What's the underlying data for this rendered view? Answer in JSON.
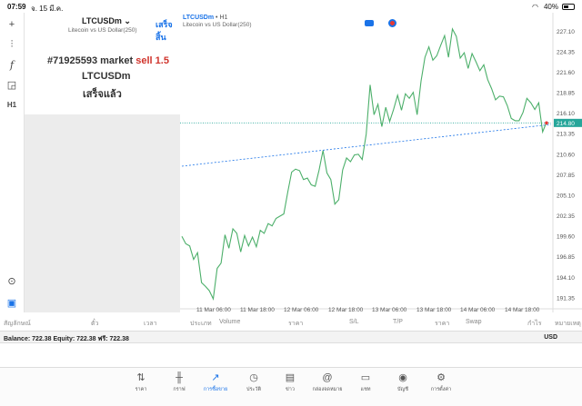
{
  "status": {
    "time": "07:59",
    "date": "จ. 15 มี.ค.",
    "battery": "40%"
  },
  "symbol": {
    "name": "LTCUSDm",
    "description": "Litecoin vs US Dollar(250)",
    "done_label": "เสร็จสิ้น"
  },
  "order": {
    "ticket": "#71925593 market",
    "side": "sell 1.5",
    "symbol": "LTCUSDm",
    "status": "เสร็จแล้ว"
  },
  "chart_header": {
    "symbol": "LTCUSDm",
    "timeframe": "H1",
    "description": "Litecoin vs US Dollar(250)"
  },
  "chart_data": {
    "type": "line",
    "y_ticks": [
      "227.10",
      "224.35",
      "221.60",
      "218.85",
      "216.10",
      "213.35",
      "210.60",
      "207.85",
      "205.10",
      "202.35",
      "199.60",
      "196.85",
      "194.10",
      "191.35"
    ],
    "x_ticks": [
      "11 Mar 06:00",
      "11 Mar 18:00",
      "12 Mar 06:00",
      "12 Mar 18:00",
      "13 Mar 06:00",
      "13 Mar 18:00",
      "14 Mar 06:00",
      "14 Mar 18:00"
    ],
    "current_price": "214.80",
    "ylim": [
      190.0,
      228.6
    ],
    "series": [
      {
        "values": [
          199.6,
          198.6,
          198.3,
          196.5,
          197.4,
          193.4,
          192.9,
          192.3,
          191.2,
          195.3,
          196.0,
          199.8,
          198.0,
          200.6,
          200.0,
          197.5,
          199.7,
          198.3,
          199.5,
          198.2,
          200.4,
          200.0,
          201.3,
          201.0,
          202.0,
          202.3,
          202.6,
          205.5,
          208.2,
          208.6,
          208.4,
          207.2,
          207.4,
          206.5,
          206.3,
          208.5,
          211.1,
          208.1,
          207.2,
          203.9,
          204.5,
          208.5,
          210.1,
          209.6,
          210.5,
          210.6,
          209.9,
          213.3,
          219.9,
          215.9,
          217.3,
          214.3,
          216.9,
          215.0,
          216.6,
          218.5,
          216.5,
          218.7,
          218.1,
          218.9,
          215.9,
          220.4,
          223.6,
          225.0,
          223.2,
          223.8,
          225.2,
          226.5,
          223.6,
          227.4,
          226.4,
          223.5,
          224.2,
          222.1,
          224.1,
          223.0,
          221.8,
          222.6,
          220.6,
          219.4,
          217.9,
          218.4,
          218.3,
          217.1,
          215.4,
          215.1,
          215.1,
          216.2,
          218.1,
          217.5,
          216.6,
          217.5,
          213.6,
          214.9
        ]
      }
    ],
    "bid_line": 214.8,
    "trend_line": {
      "start": 209.0,
      "end": 214.6
    }
  },
  "table_headers": [
    "สัญลักษณ์",
    "ตั๋ว",
    "เวลา",
    "ประเภท",
    "Volume",
    "ราคา",
    "S/L",
    "T/P",
    "ราคา",
    "Swap",
    "กำไร",
    "หมายเหตุ"
  ],
  "balance": {
    "text": "Balance: 722.38 Equity: 722.38 ฟรี: 722.38",
    "currency": "USD"
  },
  "tabs": [
    {
      "label": "ราคา",
      "icon": "arrows-icon"
    },
    {
      "label": "กราฟ",
      "icon": "candles-icon"
    },
    {
      "label": "การซื้อขาย",
      "icon": "trade-icon"
    },
    {
      "label": "ประวัติ",
      "icon": "history-icon"
    },
    {
      "label": "ข่าว",
      "icon": "news-icon"
    },
    {
      "label": "กล่องจดหมาย",
      "icon": "mail-icon"
    },
    {
      "label": "แชท",
      "icon": "chat-icon"
    },
    {
      "label": "บัญชี",
      "icon": "account-icon"
    },
    {
      "label": "การตั้งค่า",
      "icon": "settings-icon"
    }
  ],
  "colors": {
    "accent": "#1a73e8",
    "line": "#4caf6a",
    "sell": "#d0342c",
    "bid": "#26a69a",
    "price_tag": "#26a69a"
  }
}
